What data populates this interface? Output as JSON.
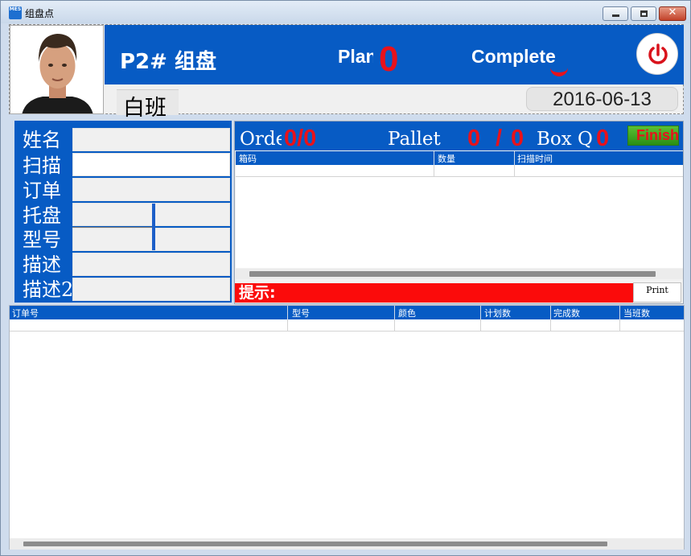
{
  "window": {
    "title": "组盘点",
    "app_icon_text": "MES",
    "close_glyph": "✕"
  },
  "header": {
    "station_title": "P2# 组盘",
    "plan_label": "Plan",
    "plan_value": "0",
    "complete_label": "Complete",
    "shift": "白班",
    "date": "2016-06-13"
  },
  "form": {
    "labels": [
      "姓名",
      "扫描",
      "订单",
      "托盘",
      "型号",
      "描述",
      "描述2"
    ],
    "values": [
      "",
      "",
      "",
      "",
      "",
      "",
      ""
    ]
  },
  "order_bar": {
    "order_label": "Order",
    "order_value": "0/0",
    "pallet_label": "Pallet",
    "pallet_done": "0",
    "pallet_sep": "/",
    "pallet_total": "0",
    "box_label": "Box Q",
    "box_value": "0",
    "finish_label": "Finish"
  },
  "box_grid": {
    "columns": [
      "箱码",
      "数量",
      "扫描时间"
    ]
  },
  "hint": {
    "label": "提示:",
    "print_label": "Print"
  },
  "order_grid": {
    "columns": [
      "订单号",
      "型号",
      "颜色",
      "计划数",
      "完成数",
      "当班数"
    ]
  },
  "colors": {
    "primary_blue": "#075bc4",
    "alert_red": "#e8121b",
    "hint_red": "#fb0b0b",
    "finish_green": "#3aa820"
  }
}
